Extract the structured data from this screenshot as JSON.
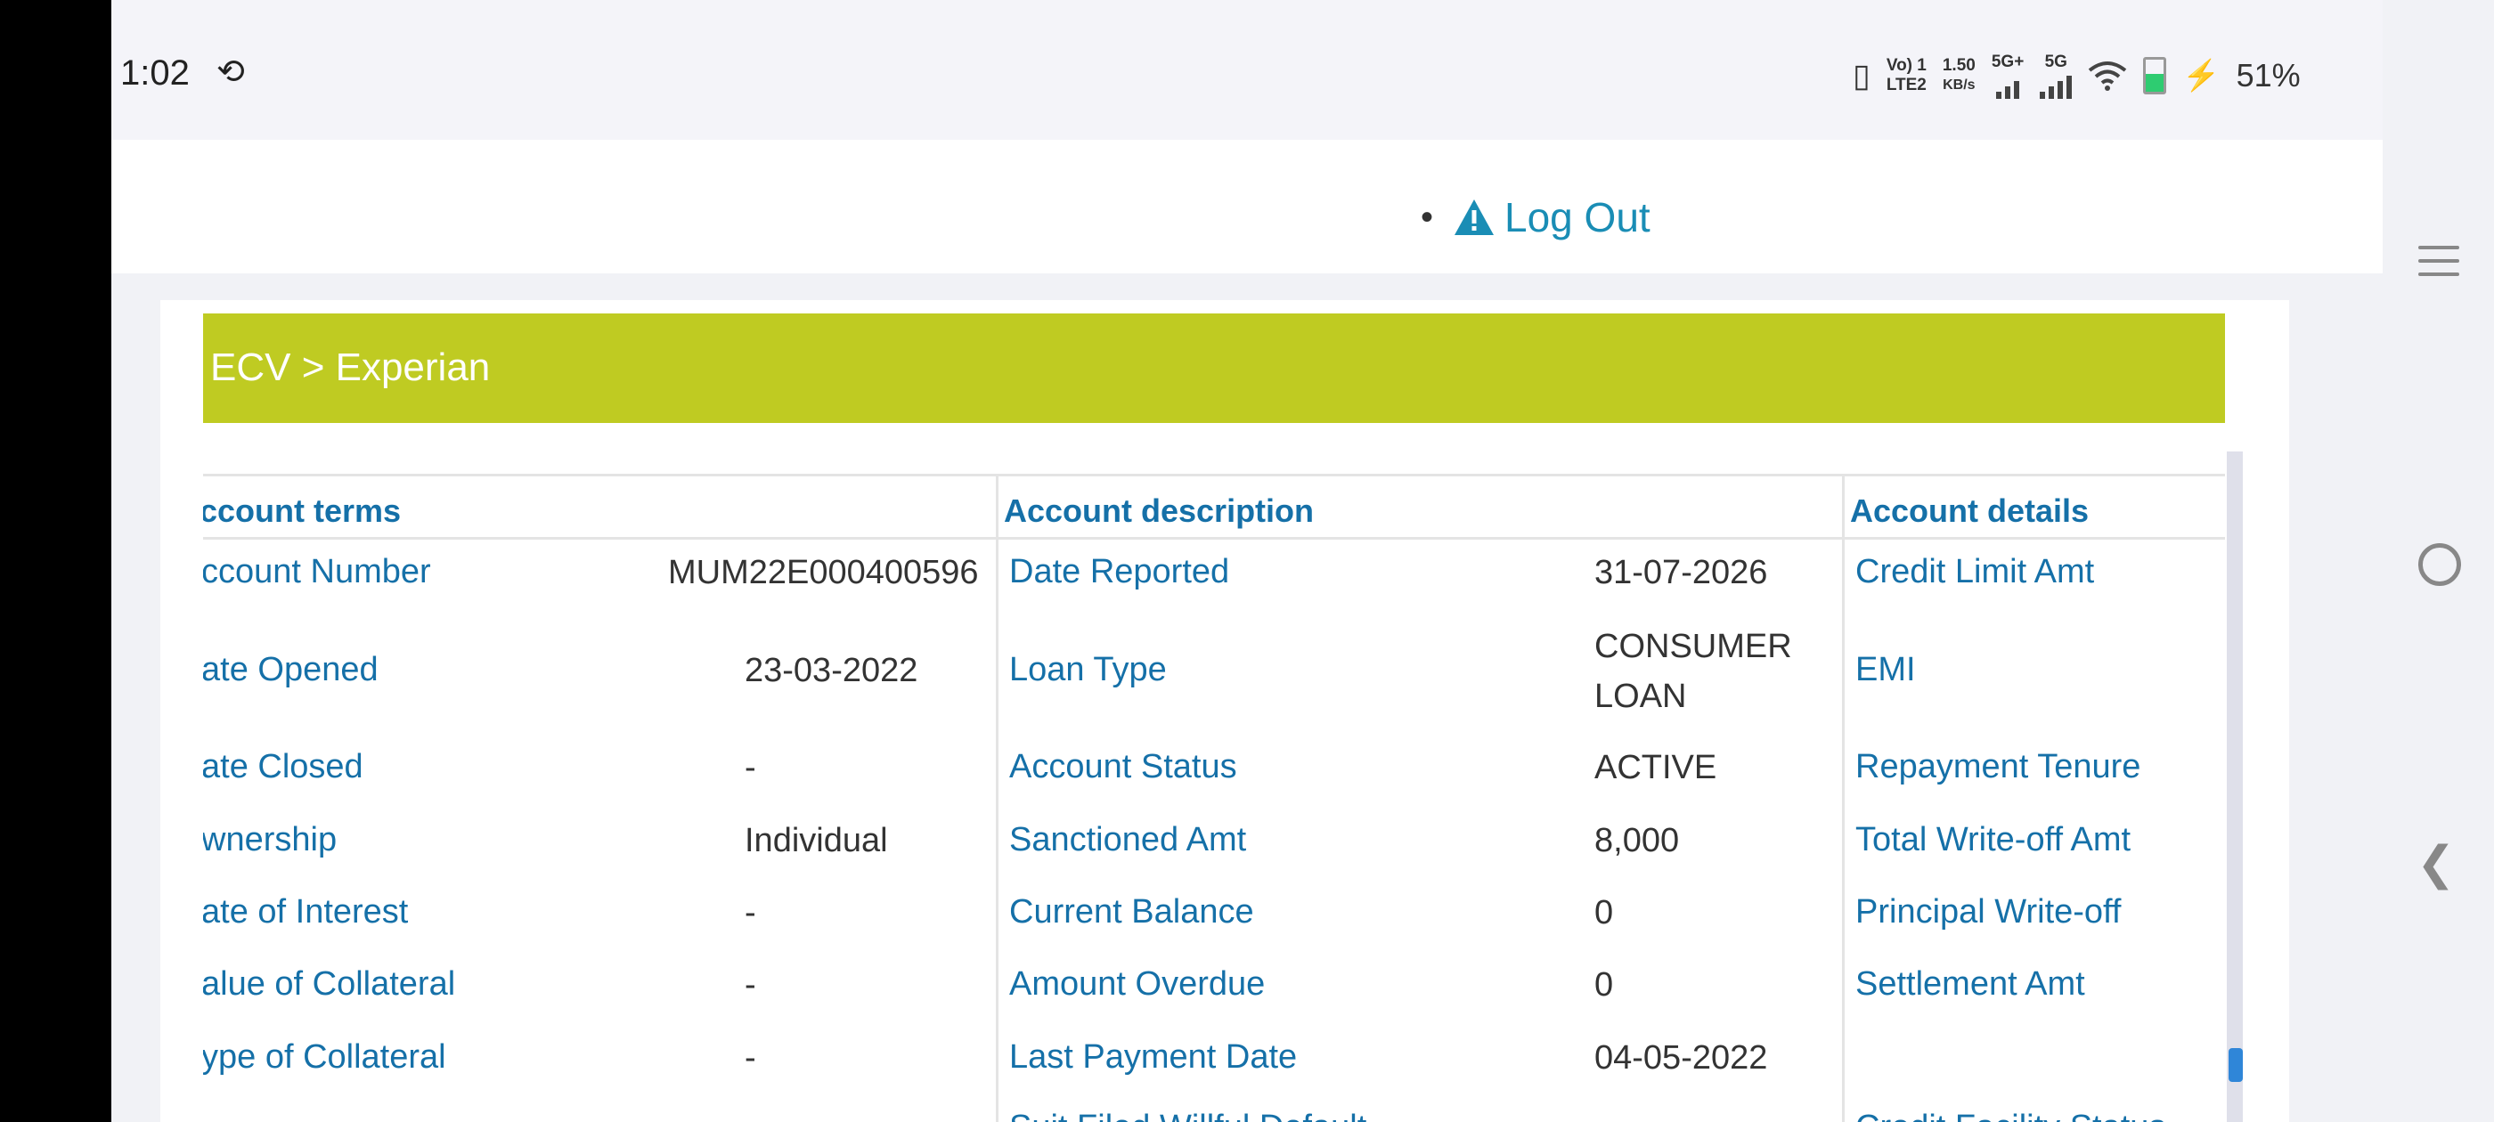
{
  "status_bar": {
    "time": "1:02",
    "sync_icon": "sync-icon",
    "net1_top": "Vo) 1",
    "net1_bottom": "LTE2",
    "speed_value": "1.50",
    "speed_unit": "KB/s",
    "net2": "5G+",
    "net3": "5G",
    "battery": "51%"
  },
  "header": {
    "logout_label": "Log Out",
    "logout_icon": "warning-icon"
  },
  "banner": {
    "breadcrumb": "ECV > Experian",
    "color": "#bfcb22"
  },
  "columns": [
    {
      "header": "ccount terms",
      "rows": [
        {
          "label": "ccount Number",
          "value": "MUM22E000400596"
        },
        {
          "label": "ate Opened",
          "value": "23-03-2022"
        },
        {
          "label": "ate Closed",
          "value": "-"
        },
        {
          "label": "wnership",
          "value": "Individual"
        },
        {
          "label": "ate of Interest",
          "value": "-"
        },
        {
          "label": "alue of Collateral",
          "value": "-"
        },
        {
          "label": "ype of Collateral",
          "value": "-"
        }
      ]
    },
    {
      "header": "Account description",
      "rows": [
        {
          "label": "Date Reported",
          "value": "31-07-2026"
        },
        {
          "label": "Loan Type",
          "value": "CONSUMER",
          "value2": "LOAN"
        },
        {
          "label": "Account Status",
          "value": "ACTIVE"
        },
        {
          "label": "Sanctioned Amt",
          "value": "8,000"
        },
        {
          "label": "Current Balance",
          "value": "0"
        },
        {
          "label": "Amount Overdue",
          "value": "0"
        },
        {
          "label": "Last Payment Date",
          "value": "04-05-2022"
        },
        {
          "label": "Suit Filed Willful Default",
          "value": ""
        }
      ]
    },
    {
      "header": "Account details",
      "rows": [
        {
          "label": "Credit Limit Amt"
        },
        {
          "label": "EMI"
        },
        {
          "label": "Repayment Tenure"
        },
        {
          "label": "Total Write-off Amt"
        },
        {
          "label": "Principal Write-off"
        },
        {
          "label": "Settlement Amt"
        },
        {
          "label": ""
        },
        {
          "label": "Credit Facility Status"
        }
      ]
    }
  ],
  "colors": {
    "link_blue": "#1570a8",
    "logout_blue": "#1a8db5"
  }
}
